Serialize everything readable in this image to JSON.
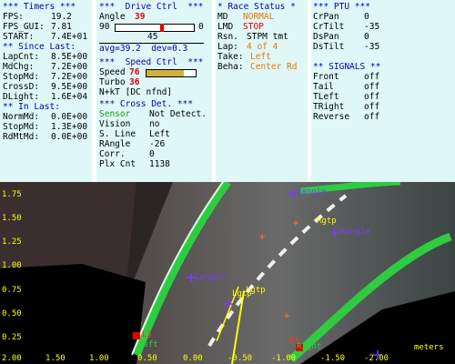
{
  "timers": {
    "header": "*** Timers ***",
    "rows": [
      {
        "label": "FPS:",
        "value": "19.2"
      },
      {
        "label": "FPS_GUI:",
        "value": "7.81"
      },
      {
        "label": "START:",
        "value": "7.4E+01"
      }
    ],
    "since_header": "** Since Last:",
    "since_rows": [
      {
        "label": "LapCnt:",
        "value": "8.5E+00"
      },
      {
        "label": "MdChg:",
        "value": "7.2E+00"
      },
      {
        "label": "StopMd:",
        "value": "7.2E+00"
      },
      {
        "label": "CrossD:",
        "value": "9.5E+00"
      },
      {
        "label": "DLight:",
        "value": "1.6E+04"
      }
    ],
    "inlast_header": "** In Last:",
    "inlast_rows": [
      {
        "label": "NormMd:",
        "value": "0.0E+00"
      },
      {
        "label": "StopMd:",
        "value": "1.3E+00"
      },
      {
        "label": "RdMtMd:",
        "value": "0.0E+00"
      }
    ]
  },
  "drive": {
    "header": "***  Drive Ctrl  ***",
    "angle_label": "Angle",
    "angle_value": "39",
    "range_min": "90",
    "range_max": "0",
    "angle_center": "45",
    "angle_fraction": 0.57,
    "avg_text": "avg=39.2  dev=0.3",
    "speed_header": "***  Speed Ctrl  ***",
    "speed_label": "Speed",
    "speed_value": "76",
    "speed_fraction": 0.76,
    "turbo_label": "Turbo",
    "turbo_value": "36",
    "mode_text": "N+kT [DC nfnd]",
    "cross_header": "*** Cross Det. ***",
    "cross_rows": [
      {
        "label": "Sensor",
        "value": "Not Detect."
      },
      {
        "label": "Vision",
        "value": "no"
      },
      {
        "label": "S. Line",
        "value": "Left"
      },
      {
        "label": "RAngle",
        "value": "-26"
      },
      {
        "label": "Corr.",
        "value": "0"
      },
      {
        "label": "Plx Cnt",
        "value": "1138"
      }
    ]
  },
  "race": {
    "header": "* Race Status *",
    "md_label": "MD",
    "md_value": "NORMAL",
    "lmd_label": "LMD",
    "lmd_value": "STOP",
    "rsn_label": "Rsn.",
    "rsn_value": "STPM tmt",
    "lap_label": "Lap:",
    "lap_value": "4 of 4",
    "take_label": "Take:",
    "take_value": "Left",
    "beha_label": "Beha:",
    "beha_value": "Center Rd"
  },
  "ptu": {
    "header": "*** PTU ***",
    "rows": [
      {
        "label": "CrPan",
        "value": "0"
      },
      {
        "label": "CrTilt",
        "value": "-35"
      },
      {
        "label": "DsPan",
        "value": "0"
      },
      {
        "label": "DsTilt",
        "value": "-35"
      }
    ],
    "signals_header": "** SIGNALS **",
    "signals": [
      {
        "label": "Front",
        "value": "off"
      },
      {
        "label": "Tail",
        "value": "off"
      },
      {
        "label": "TLeft",
        "value": "off"
      },
      {
        "label": "TRight",
        "value": "off"
      },
      {
        "label": "Reverse",
        "value": "off"
      }
    ]
  },
  "camera": {
    "y_ticks": [
      "1.75",
      "1.50",
      "1.25",
      "1.00",
      "0.75",
      "0.50",
      "0.25"
    ],
    "x_ticks": [
      "2.00",
      "1.50",
      "1.00",
      "0.50",
      "0.00",
      "-0.50",
      "-1.00",
      "-1.50",
      "-2.00"
    ],
    "units": "meters",
    "overlay_labels": [
      "Rgtp",
      "Lgtp",
      "Lgtp",
      "Left",
      "Right",
      "L3",
      "R3"
    ],
    "overlay_labels_faint": [
      "Rangle",
      "Langle",
      "Rangle"
    ]
  },
  "colors": {
    "panel_bg": "#dff7f7",
    "header_blue": "#0000b8",
    "alert_red": "#e00000",
    "status_orange": "#e87800",
    "lane_green": "#2ecc40",
    "overlay_yellow": "#ffff00",
    "overlay_purple": "#7a3cff"
  }
}
